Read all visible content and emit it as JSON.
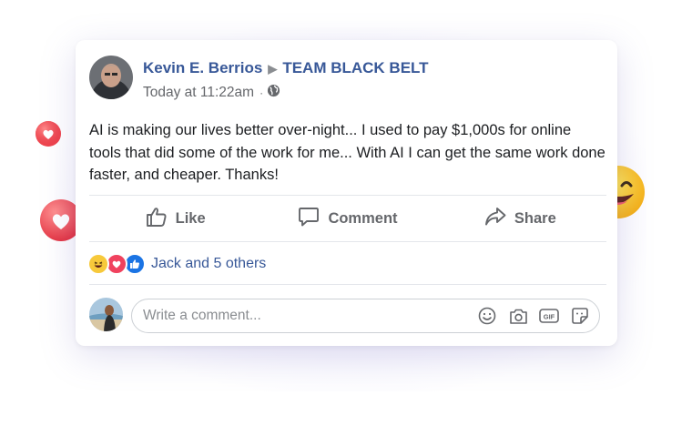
{
  "post": {
    "author": "Kevin E. Berrios",
    "group": "TEAM BLACK BELT",
    "timestamp": "Today at 11:22am",
    "text": "AI is making our lives better over-night... I used to pay $1,000s for online tools that did some of the work for me... With AI I can get the same work done faster, and cheaper. Thanks!"
  },
  "actions": {
    "like": "Like",
    "comment": "Comment",
    "share": "Share"
  },
  "reactions": {
    "label": "Jack and 5 others"
  },
  "composer": {
    "placeholder": "Write a comment..."
  },
  "icons": [
    "globe-icon",
    "like-icon",
    "comment-icon",
    "share-icon",
    "emoji-icon",
    "camera-icon",
    "gif-icon",
    "sticker-icon"
  ],
  "colors": {
    "link": "#385898",
    "muted": "#65676b",
    "love": "#f0425e",
    "like": "#1b74e4",
    "haha": "#f7c93b"
  }
}
